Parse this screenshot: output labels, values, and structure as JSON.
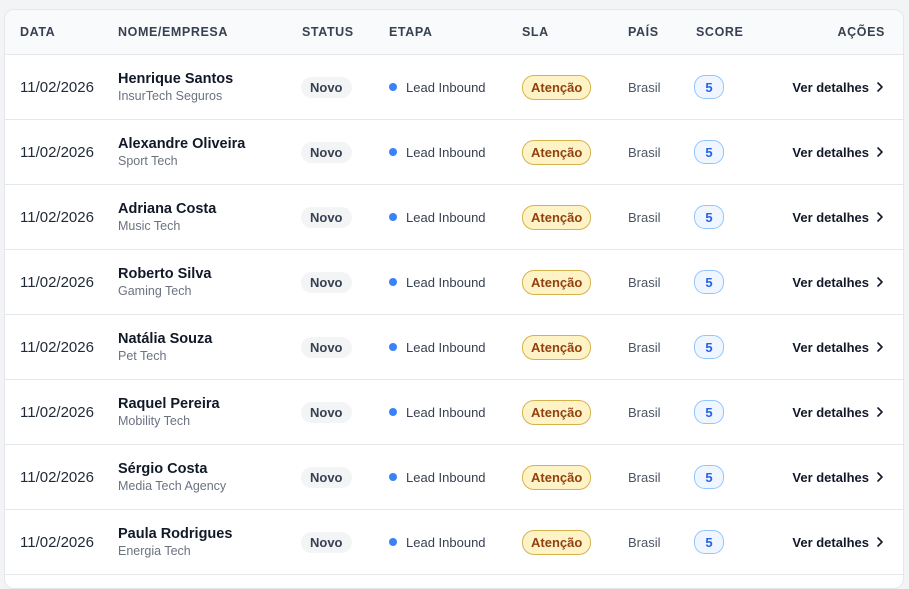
{
  "table": {
    "headers": {
      "data": "DATA",
      "nome_empresa": "NOME/EMPRESA",
      "status": "STATUS",
      "etapa": "ETAPA",
      "sla": "SLA",
      "pais": "PAÍS",
      "score": "SCORE",
      "acoes": "AÇÕES"
    },
    "action_label": "Ver detalhes",
    "colors": {
      "etapa_dot": "#3b82f6",
      "sla_bg": "#fef3c7",
      "score_text": "#2563eb"
    },
    "rows": [
      {
        "date": "11/02/2026",
        "name": "Henrique Santos",
        "company": "InsurTech Seguros",
        "status": "Novo",
        "etapa": "Lead Inbound",
        "sla": "Atenção",
        "pais": "Brasil",
        "score": "5"
      },
      {
        "date": "11/02/2026",
        "name": "Alexandre Oliveira",
        "company": "Sport Tech",
        "status": "Novo",
        "etapa": "Lead Inbound",
        "sla": "Atenção",
        "pais": "Brasil",
        "score": "5"
      },
      {
        "date": "11/02/2026",
        "name": "Adriana Costa",
        "company": "Music Tech",
        "status": "Novo",
        "etapa": "Lead Inbound",
        "sla": "Atenção",
        "pais": "Brasil",
        "score": "5"
      },
      {
        "date": "11/02/2026",
        "name": "Roberto Silva",
        "company": "Gaming Tech",
        "status": "Novo",
        "etapa": "Lead Inbound",
        "sla": "Atenção",
        "pais": "Brasil",
        "score": "5"
      },
      {
        "date": "11/02/2026",
        "name": "Natália Souza",
        "company": "Pet Tech",
        "status": "Novo",
        "etapa": "Lead Inbound",
        "sla": "Atenção",
        "pais": "Brasil",
        "score": "5"
      },
      {
        "date": "11/02/2026",
        "name": "Raquel Pereira",
        "company": "Mobility Tech",
        "status": "Novo",
        "etapa": "Lead Inbound",
        "sla": "Atenção",
        "pais": "Brasil",
        "score": "5"
      },
      {
        "date": "11/02/2026",
        "name": "Sérgio Costa",
        "company": "Media Tech Agency",
        "status": "Novo",
        "etapa": "Lead Inbound",
        "sla": "Atenção",
        "pais": "Brasil",
        "score": "5"
      },
      {
        "date": "11/02/2026",
        "name": "Paula Rodrigues",
        "company": "Energia Tech",
        "status": "Novo",
        "etapa": "Lead Inbound",
        "sla": "Atenção",
        "pais": "Brasil",
        "score": "5"
      }
    ]
  }
}
